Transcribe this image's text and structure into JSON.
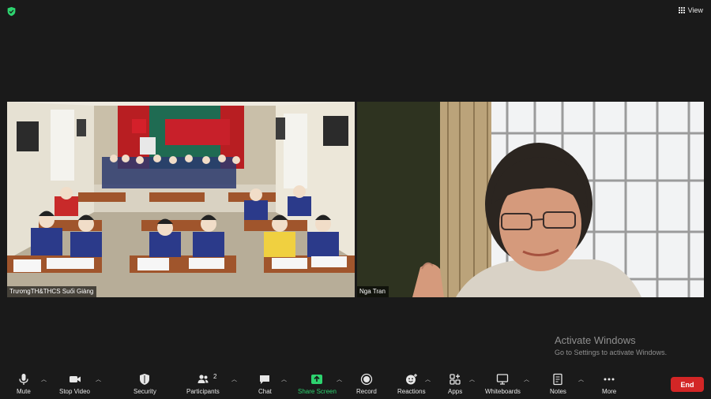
{
  "security_status": {
    "icon": "green-shield-icon",
    "color": "#2dd36f"
  },
  "view_button": {
    "label": "View",
    "icon": "grid-icon"
  },
  "participants": [
    {
      "name": "TrươngTH&THCS Suối Giàng",
      "video": "classroom-camera-feed"
    },
    {
      "name": "Nga Tran",
      "video": "webcam-feed"
    }
  ],
  "watermark": {
    "title": "Activate Windows",
    "subtitle": "Go to Settings to activate Windows."
  },
  "toolbar": {
    "mute": {
      "label": "Mute",
      "icon": "microphone-icon"
    },
    "stop_video": {
      "label": "Stop Video",
      "icon": "video-camera-icon"
    },
    "security": {
      "label": "Security",
      "icon": "shield-icon"
    },
    "participants": {
      "label": "Participants",
      "icon": "people-icon",
      "count": "2"
    },
    "chat": {
      "label": "Chat",
      "icon": "chat-bubble-icon"
    },
    "share_screen": {
      "label": "Share Screen",
      "icon": "share-arrow-icon",
      "color": "#2dd36f"
    },
    "record": {
      "label": "Record",
      "icon": "record-icon"
    },
    "reactions": {
      "label": "Reactions",
      "icon": "smiley-plus-icon"
    },
    "apps": {
      "label": "Apps",
      "icon": "apps-icon"
    },
    "whiteboards": {
      "label": "Whiteboards",
      "icon": "whiteboard-icon"
    },
    "notes": {
      "label": "Notes",
      "icon": "notes-icon"
    },
    "more": {
      "label": "More",
      "icon": "ellipsis-icon"
    },
    "end": {
      "label": "End",
      "color": "#d32626"
    }
  }
}
